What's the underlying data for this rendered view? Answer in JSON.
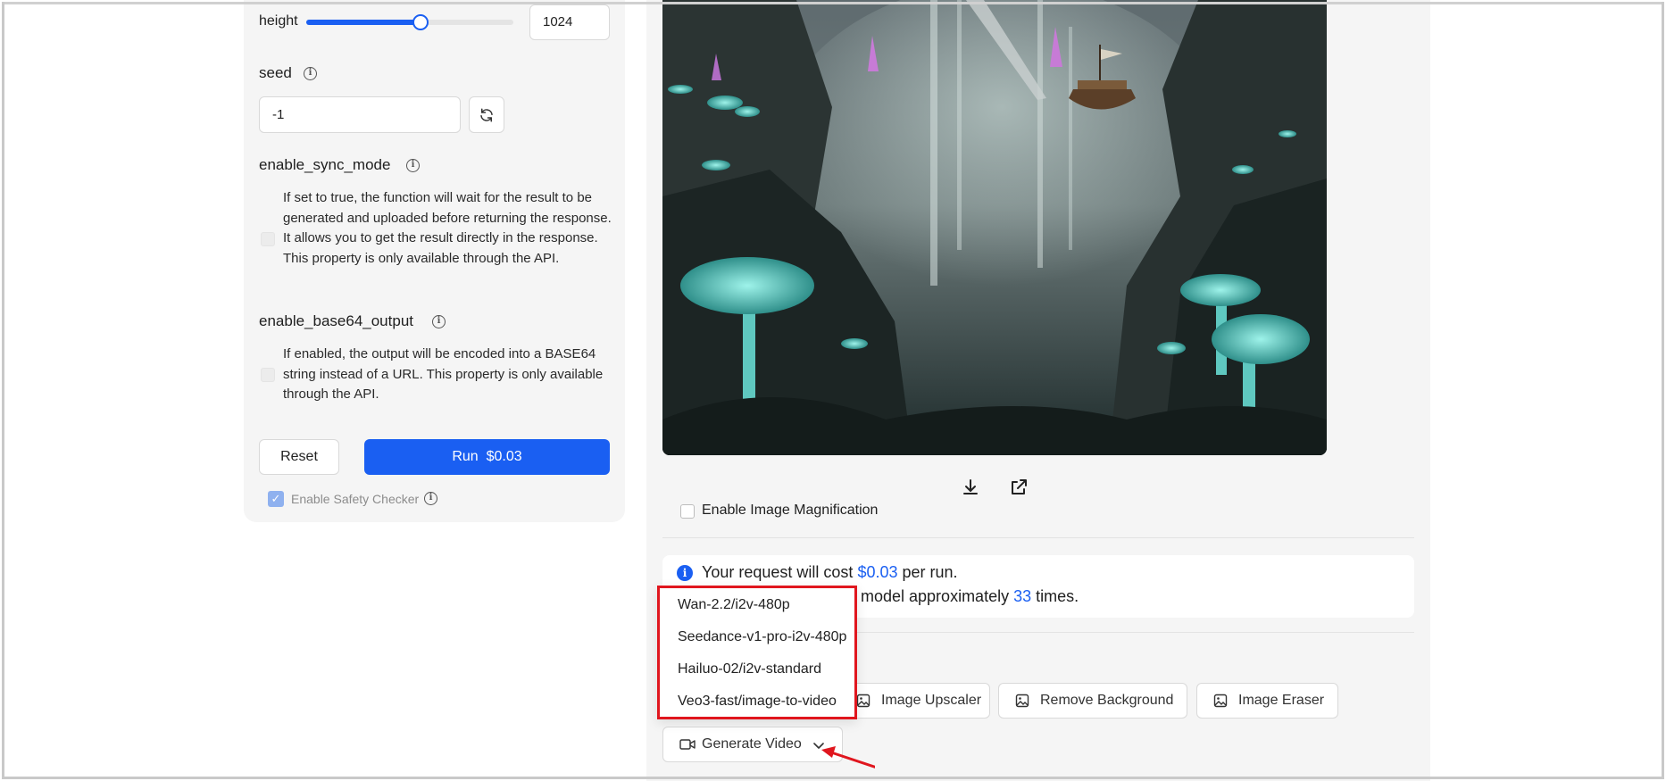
{
  "left": {
    "height": {
      "label": "height",
      "value": "1024",
      "fraction": 0.55
    },
    "seed": {
      "label": "seed",
      "value": "-1"
    },
    "sync_mode": {
      "label": "enable_sync_mode",
      "description": "If set to true, the function will wait for the result to be generated and uploaded before returning the response. It allows you to get the result directly in the response. This property is only available through the API.",
      "checked": false
    },
    "base64": {
      "label": "enable_base64_output",
      "description": "If enabled, the output will be encoded into a BASE64 string instead of a URL. This property is only available through the API.",
      "checked": false
    },
    "reset_label": "Reset",
    "run_label": "Run",
    "run_price": "$0.03",
    "safety_label": "Enable Safety Checker",
    "safety_checked": true
  },
  "right": {
    "magnification_label": "Enable Image Magnification",
    "cost": {
      "line1_prefix": "Your request will cost",
      "price": "$0.03",
      "line1_suffix": "per run.",
      "line2_prefix": "s model approximately",
      "runs": "33",
      "line2_suffix": "times."
    },
    "tools": {
      "upscaler": "Image Upscaler",
      "remove_bg": "Remove Background",
      "eraser": "Image Eraser"
    },
    "generate_video_label": "Generate Video",
    "dropdown_items": [
      "Wan-2.2/i2v-480p",
      "Seedance-v1-pro-i2v-480p",
      "Hailuo-02/i2v-standard",
      "Veo3-fast/image-to-video"
    ]
  },
  "colors": {
    "accent": "#1a5ff2",
    "highlight_border": "#e0161e",
    "panel_bg": "#f5f5f5"
  },
  "icons": [
    "info-icon",
    "refresh-icon",
    "download-icon",
    "external-link-icon",
    "image-icon",
    "video-camera-icon",
    "chevron-down-icon",
    "check-icon"
  ]
}
